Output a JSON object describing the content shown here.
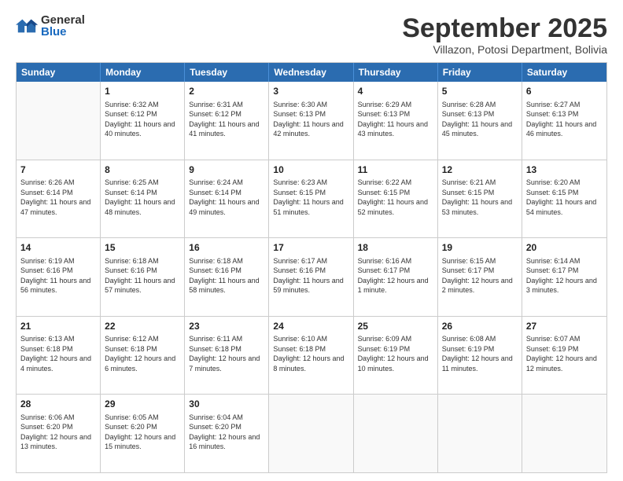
{
  "logo": {
    "general": "General",
    "blue": "Blue"
  },
  "title": "September 2025",
  "subtitle": "Villazon, Potosi Department, Bolivia",
  "days": [
    "Sunday",
    "Monday",
    "Tuesday",
    "Wednesday",
    "Thursday",
    "Friday",
    "Saturday"
  ],
  "weeks": [
    [
      {
        "day": "",
        "empty": true
      },
      {
        "day": "1",
        "sunrise": "6:32 AM",
        "sunset": "6:12 PM",
        "daylight": "11 hours and 40 minutes."
      },
      {
        "day": "2",
        "sunrise": "6:31 AM",
        "sunset": "6:12 PM",
        "daylight": "11 hours and 41 minutes."
      },
      {
        "day": "3",
        "sunrise": "6:30 AM",
        "sunset": "6:13 PM",
        "daylight": "11 hours and 42 minutes."
      },
      {
        "day": "4",
        "sunrise": "6:29 AM",
        "sunset": "6:13 PM",
        "daylight": "11 hours and 43 minutes."
      },
      {
        "day": "5",
        "sunrise": "6:28 AM",
        "sunset": "6:13 PM",
        "daylight": "11 hours and 45 minutes."
      },
      {
        "day": "6",
        "sunrise": "6:27 AM",
        "sunset": "6:13 PM",
        "daylight": "11 hours and 46 minutes."
      }
    ],
    [
      {
        "day": "7",
        "sunrise": "6:26 AM",
        "sunset": "6:14 PM",
        "daylight": "11 hours and 47 minutes."
      },
      {
        "day": "8",
        "sunrise": "6:25 AM",
        "sunset": "6:14 PM",
        "daylight": "11 hours and 48 minutes."
      },
      {
        "day": "9",
        "sunrise": "6:24 AM",
        "sunset": "6:14 PM",
        "daylight": "11 hours and 49 minutes."
      },
      {
        "day": "10",
        "sunrise": "6:23 AM",
        "sunset": "6:15 PM",
        "daylight": "11 hours and 51 minutes."
      },
      {
        "day": "11",
        "sunrise": "6:22 AM",
        "sunset": "6:15 PM",
        "daylight": "11 hours and 52 minutes."
      },
      {
        "day": "12",
        "sunrise": "6:21 AM",
        "sunset": "6:15 PM",
        "daylight": "11 hours and 53 minutes."
      },
      {
        "day": "13",
        "sunrise": "6:20 AM",
        "sunset": "6:15 PM",
        "daylight": "11 hours and 54 minutes."
      }
    ],
    [
      {
        "day": "14",
        "sunrise": "6:19 AM",
        "sunset": "6:16 PM",
        "daylight": "11 hours and 56 minutes."
      },
      {
        "day": "15",
        "sunrise": "6:18 AM",
        "sunset": "6:16 PM",
        "daylight": "11 hours and 57 minutes."
      },
      {
        "day": "16",
        "sunrise": "6:18 AM",
        "sunset": "6:16 PM",
        "daylight": "11 hours and 58 minutes."
      },
      {
        "day": "17",
        "sunrise": "6:17 AM",
        "sunset": "6:16 PM",
        "daylight": "11 hours and 59 minutes."
      },
      {
        "day": "18",
        "sunrise": "6:16 AM",
        "sunset": "6:17 PM",
        "daylight": "12 hours and 1 minute."
      },
      {
        "day": "19",
        "sunrise": "6:15 AM",
        "sunset": "6:17 PM",
        "daylight": "12 hours and 2 minutes."
      },
      {
        "day": "20",
        "sunrise": "6:14 AM",
        "sunset": "6:17 PM",
        "daylight": "12 hours and 3 minutes."
      }
    ],
    [
      {
        "day": "21",
        "sunrise": "6:13 AM",
        "sunset": "6:18 PM",
        "daylight": "12 hours and 4 minutes."
      },
      {
        "day": "22",
        "sunrise": "6:12 AM",
        "sunset": "6:18 PM",
        "daylight": "12 hours and 6 minutes."
      },
      {
        "day": "23",
        "sunrise": "6:11 AM",
        "sunset": "6:18 PM",
        "daylight": "12 hours and 7 minutes."
      },
      {
        "day": "24",
        "sunrise": "6:10 AM",
        "sunset": "6:18 PM",
        "daylight": "12 hours and 8 minutes."
      },
      {
        "day": "25",
        "sunrise": "6:09 AM",
        "sunset": "6:19 PM",
        "daylight": "12 hours and 10 minutes."
      },
      {
        "day": "26",
        "sunrise": "6:08 AM",
        "sunset": "6:19 PM",
        "daylight": "12 hours and 11 minutes."
      },
      {
        "day": "27",
        "sunrise": "6:07 AM",
        "sunset": "6:19 PM",
        "daylight": "12 hours and 12 minutes."
      }
    ],
    [
      {
        "day": "28",
        "sunrise": "6:06 AM",
        "sunset": "6:20 PM",
        "daylight": "12 hours and 13 minutes."
      },
      {
        "day": "29",
        "sunrise": "6:05 AM",
        "sunset": "6:20 PM",
        "daylight": "12 hours and 15 minutes."
      },
      {
        "day": "30",
        "sunrise": "6:04 AM",
        "sunset": "6:20 PM",
        "daylight": "12 hours and 16 minutes."
      },
      {
        "day": "",
        "empty": true
      },
      {
        "day": "",
        "empty": true
      },
      {
        "day": "",
        "empty": true
      },
      {
        "day": "",
        "empty": true
      }
    ]
  ],
  "labels": {
    "sunrise": "Sunrise:",
    "sunset": "Sunset:",
    "daylight": "Daylight:"
  }
}
